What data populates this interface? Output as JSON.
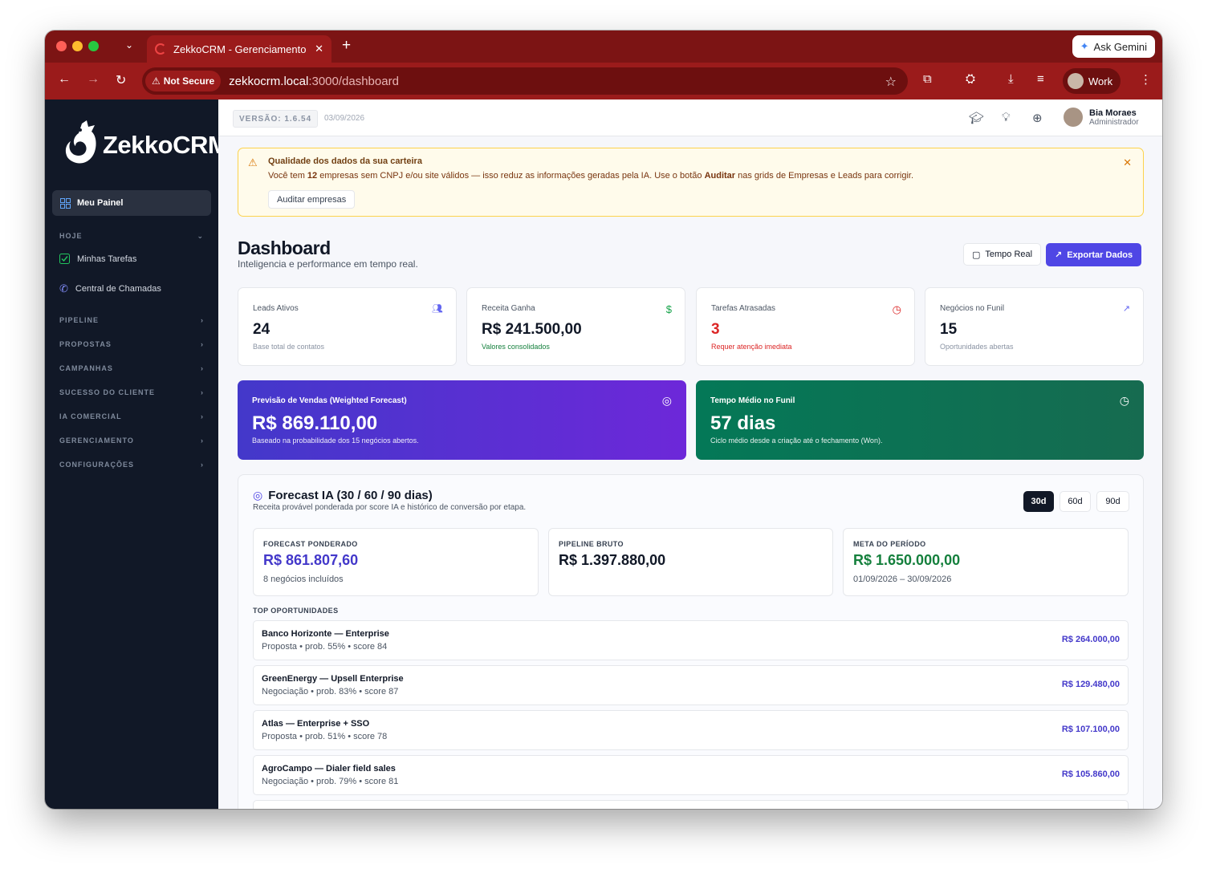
{
  "browser": {
    "tab_title": "ZekkoCRM - Gerenciamento I",
    "ask_gemini": "Ask Gemini",
    "not_secure": "Not Secure",
    "url_host": "zekkocrm.local",
    "url_path": ":3000/dashboard",
    "profile": "Work"
  },
  "sidebar": {
    "logo_text": "ZekkoCRM",
    "active_item": "Meu Painel",
    "sections": [
      {
        "label": "HOJE"
      },
      {
        "label": "PIPELINE"
      },
      {
        "label": "PROPOSTAS"
      },
      {
        "label": "CAMPANHAS"
      },
      {
        "label": "SUCESSO DO CLIENTE"
      },
      {
        "label": "IA COMERCIAL"
      },
      {
        "label": "GERENCIAMENTO"
      },
      {
        "label": "CONFIGURAÇÕES"
      }
    ],
    "today_items": [
      {
        "label": "Minhas Tarefas"
      },
      {
        "label": "Central de Chamadas"
      }
    ]
  },
  "topbar": {
    "version": "VERSÃO: 1.6.54",
    "date": "03/09/2026",
    "user_name": "Bia Moraes",
    "user_role": "Administrador"
  },
  "alert": {
    "title": "Qualidade dos dados da sua carteira",
    "msg_before": "Você tem ",
    "msg_count": "12",
    "msg_middle": " empresas sem CNPJ e/ou site válidos — isso reduz as informações geradas pela IA. Use o botão ",
    "msg_bold": "Auditar",
    "msg_after": " nas grids de Empresas e Leads para corrigir.",
    "button": "Auditar empresas"
  },
  "header": {
    "title": "Dashboard",
    "subtitle": "Inteligencia e performance em tempo real.",
    "btn_realtime": "Tempo Real",
    "btn_export": "Exportar Dados"
  },
  "kpis": [
    {
      "label": "Leads Ativos",
      "value": "24",
      "sub": "Base total de contatos",
      "color": "#111827",
      "sub_color": "#8a93a3",
      "icon_color": "#6366f1"
    },
    {
      "label": "Receita Ganha",
      "value": "R$ 241.500,00",
      "sub": "Valores consolidados",
      "color": "#111827",
      "sub_color": "#15803d",
      "icon_color": "#16a34a"
    },
    {
      "label": "Tarefas Atrasadas",
      "value": "3",
      "sub": "Requer atenção imediata",
      "color": "#dc2626",
      "sub_color": "#dc2626",
      "icon_color": "#dc2626"
    },
    {
      "label": "Negócios no Funil",
      "value": "15",
      "sub": "Oportunidades abertas",
      "color": "#111827",
      "sub_color": "#8a93a3",
      "icon_color": "#6366f1"
    }
  ],
  "forecast_card": {
    "label": "Previsão de Vendas (Weighted Forecast)",
    "value": "R$ 869.110,00",
    "sub": "Baseado na probabilidade dos 15 negócios abertos."
  },
  "funnel_card": {
    "label": "Tempo Médio no Funil",
    "value": "57 dias",
    "sub": "Ciclo médio desde a criação até o fechamento (Won)."
  },
  "forecast_ia": {
    "title": "Forecast IA (30 / 60 / 90 dias)",
    "subtitle": "Receita provável ponderada por score IA e histórico de conversão por etapa.",
    "periods": [
      "30d",
      "60d",
      "90d"
    ],
    "active_period": "30d",
    "metrics": [
      {
        "label": "FORECAST PONDERADO",
        "value": "R$ 861.807,60",
        "sub": "8 negócios incluídos",
        "color": "#4338ca"
      },
      {
        "label": "PIPELINE BRUTO",
        "value": "R$ 1.397.880,00",
        "sub": "",
        "color": "#111827"
      },
      {
        "label": "META DO PERÍODO",
        "value": "R$ 1.650.000,00",
        "sub": "01/09/2026 – 30/09/2026",
        "color": "#15803d"
      }
    ],
    "top_label": "TOP OPORTUNIDADES",
    "opportunities": [
      {
        "title": "Banco Horizonte — Enterprise",
        "detail": "Proposta • prob. 55% • score 84",
        "value": "R$ 264.000,00"
      },
      {
        "title": "GreenEnergy — Upsell Enterprise",
        "detail": "Negociação • prob. 83% • score 87",
        "value": "R$ 129.480,00"
      },
      {
        "title": "Atlas — Enterprise + SSO",
        "detail": "Proposta • prob. 51% • score 78",
        "value": "R$ 107.100,00"
      },
      {
        "title": "AgroCampo — Dialer field sales",
        "detail": "Negociação • prob. 79% • score 81",
        "value": "R$ 105.860,00"
      }
    ]
  }
}
